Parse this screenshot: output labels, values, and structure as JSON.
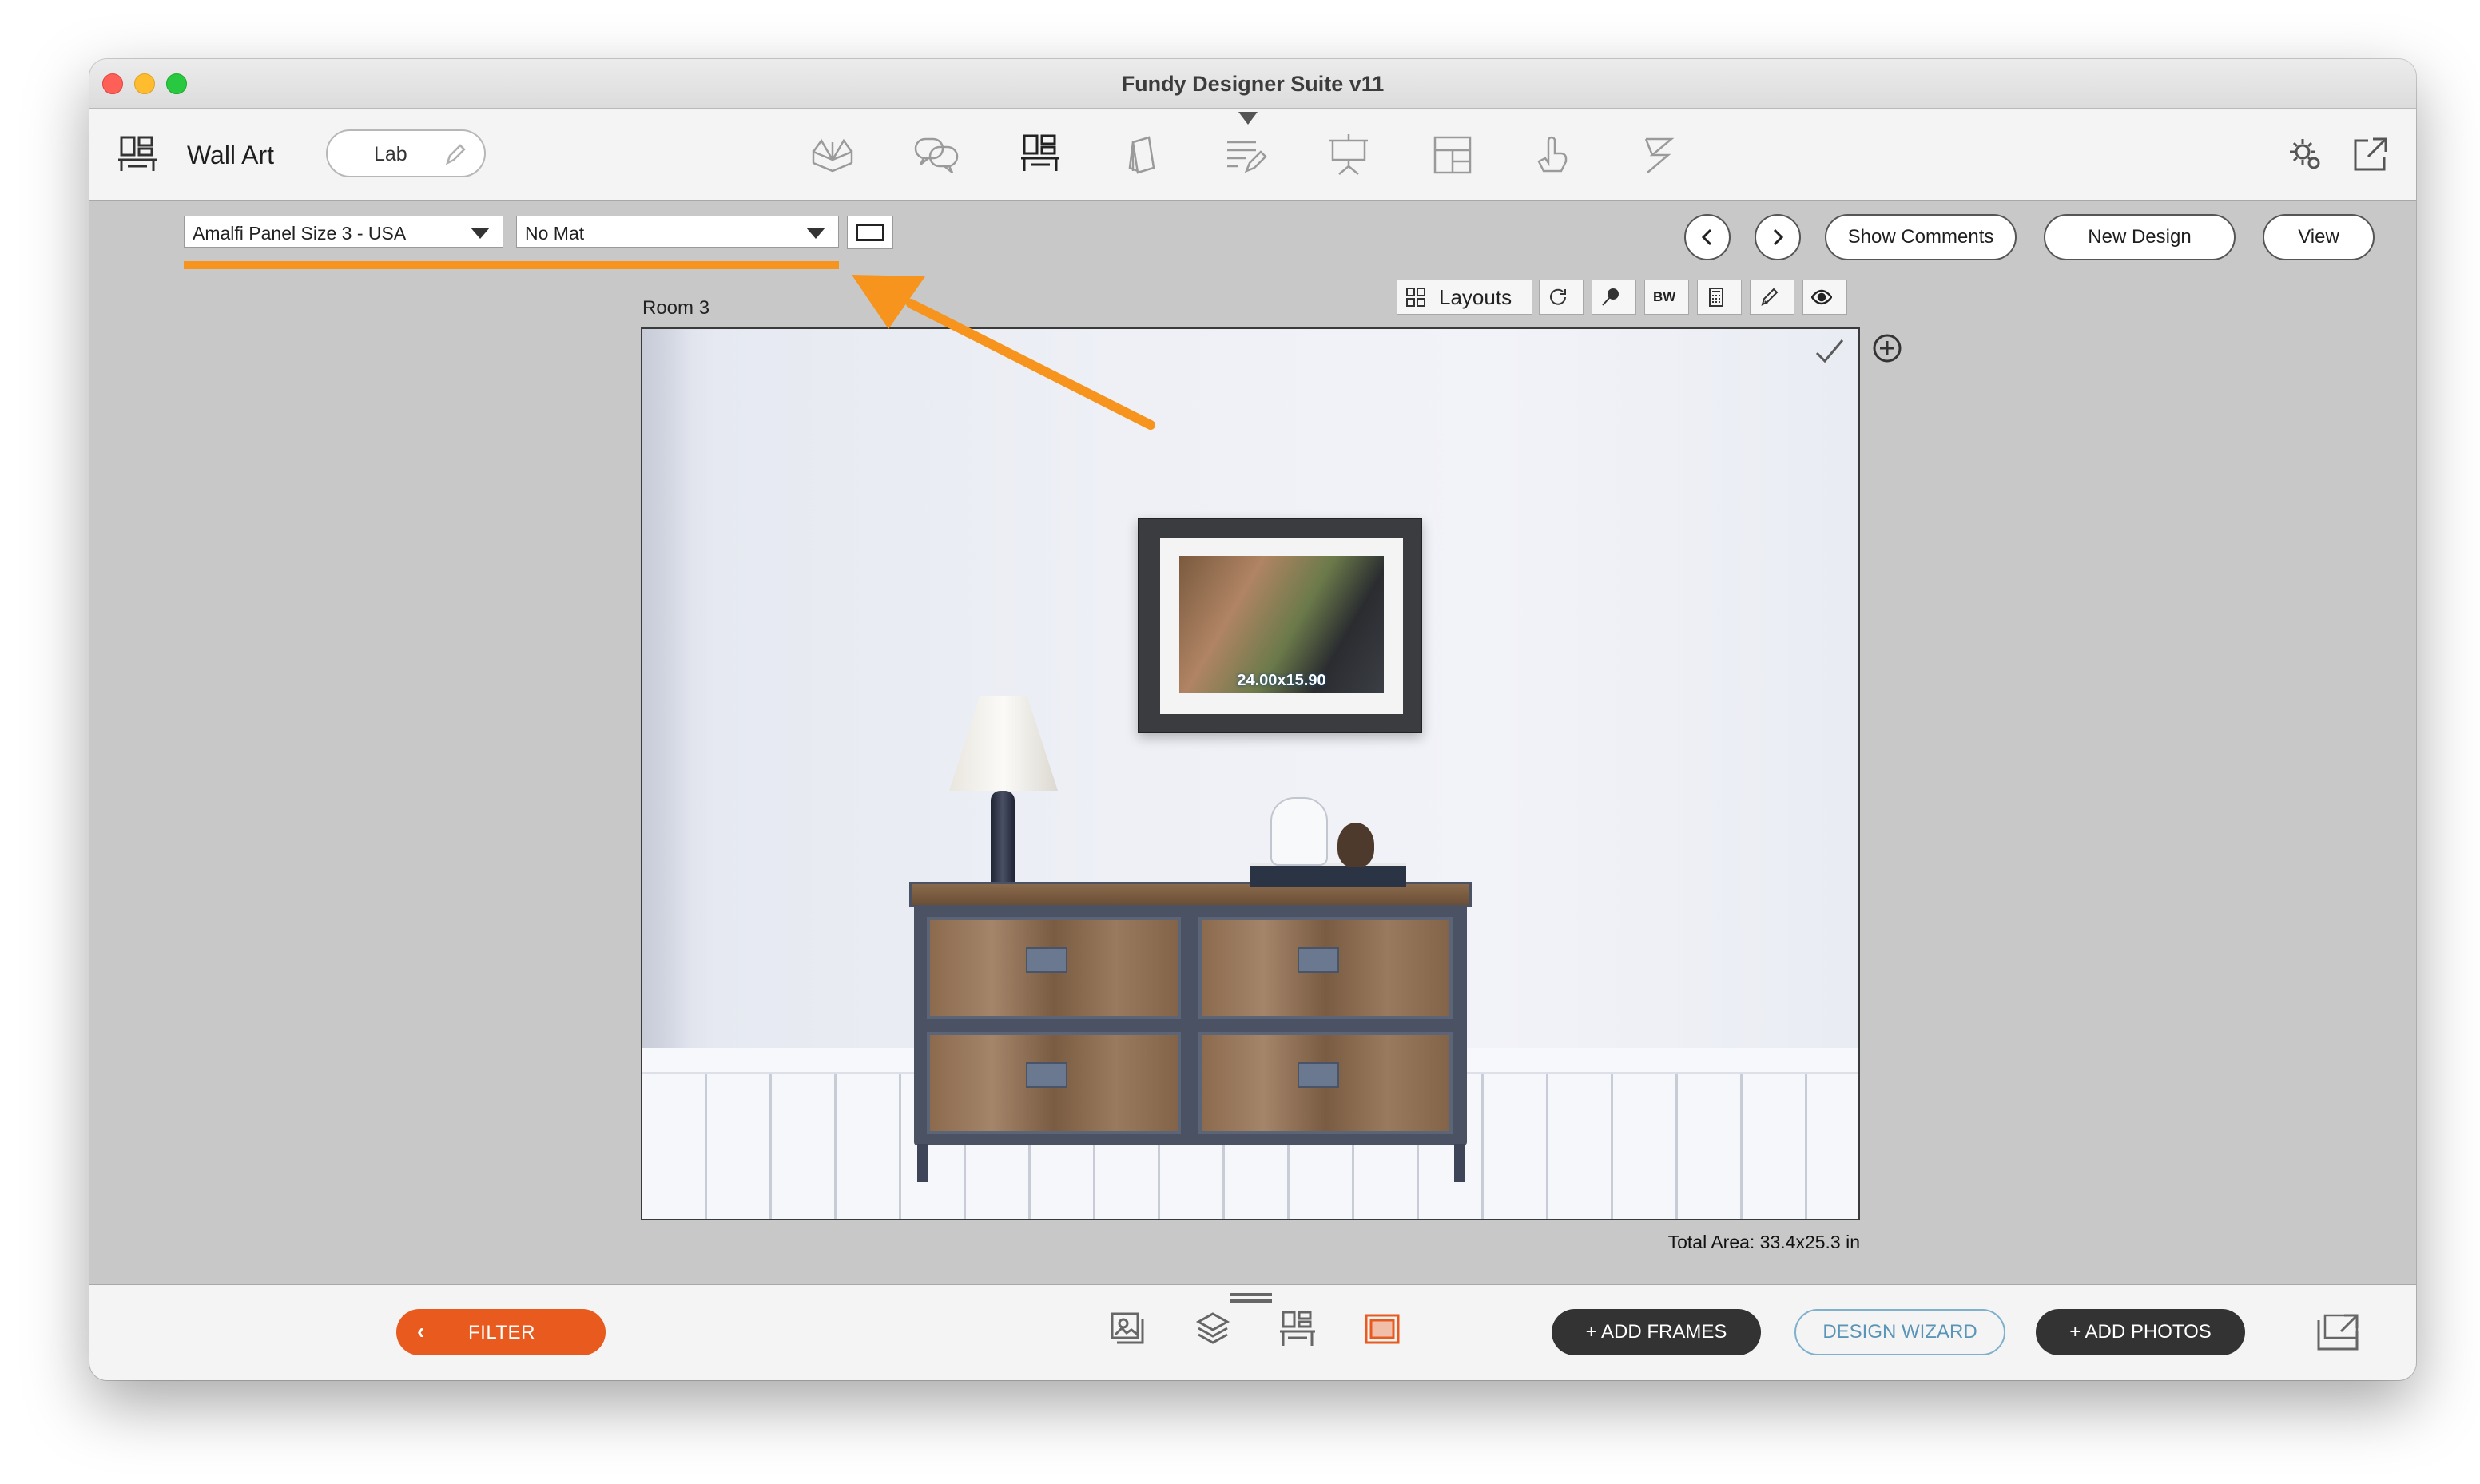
{
  "window": {
    "title": "Fundy Designer Suite v11"
  },
  "toolbar": {
    "module_title": "Wall Art",
    "lab_label": "Lab",
    "icons": [
      "wall-art-module-icon",
      "album-icon",
      "chat-icon",
      "wall-art-icon",
      "cards-icon",
      "text-icon",
      "slideshow-icon",
      "layout-icon",
      "hand-icon",
      "blog-icon",
      "settings-icon",
      "export-icon"
    ]
  },
  "controls": {
    "product_select": "Amalfi Panel Size 3 - USA",
    "mat_select": "No Mat",
    "show_comments": "Show Comments",
    "new_design": "New Design",
    "view": "View"
  },
  "room": {
    "label": "Room 3",
    "layouts_label": "Layouts",
    "bw_label": "BW",
    "photo_size": "24.00x15.90",
    "total_area": "Total Area: 33.4x25.3 in"
  },
  "bottombar": {
    "filter": "FILTER",
    "add_frames": "+ ADD FRAMES",
    "design_wizard": "DESIGN WIZARD",
    "add_photos": "+ ADD PHOTOS"
  },
  "colors": {
    "accent_orange": "#f7941d",
    "filter_orange": "#e85a1d",
    "wizard_blue": "#5a95b8",
    "dark_button": "#333333"
  }
}
